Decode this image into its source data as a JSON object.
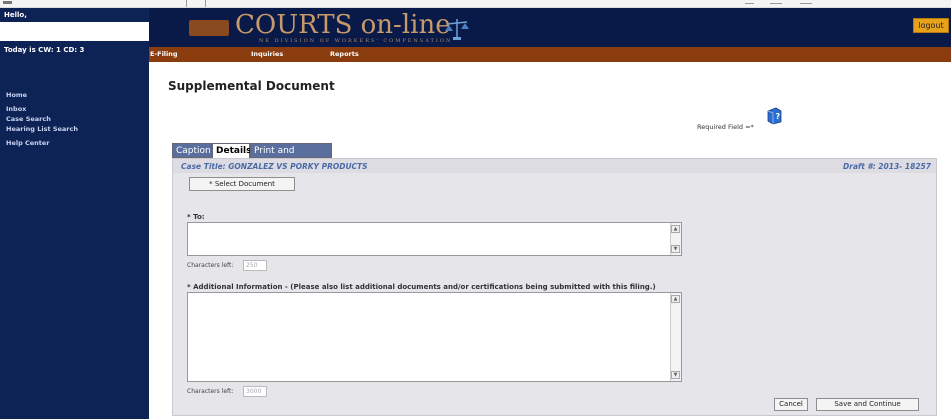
{
  "sidebar": {
    "greeting": "Hello,",
    "today": "Today is CW: 1 CD: 3",
    "items": [
      {
        "label": "Home"
      },
      {
        "label": "Inbox"
      },
      {
        "label": "Case Search"
      },
      {
        "label": "Hearing List Search"
      },
      {
        "label": "Help Center"
      }
    ]
  },
  "banner": {
    "title": "COURTS on-line",
    "subtitle": "NE DIVISION OF WORKERS' COMPENSATION",
    "logout_label": "logout"
  },
  "menu": {
    "items": [
      {
        "label": "E-Filing"
      },
      {
        "label": "Inquiries"
      },
      {
        "label": "Reports"
      }
    ]
  },
  "page": {
    "title": "Supplemental Document",
    "required_note": "Required Field =*"
  },
  "tabs": [
    {
      "label": "Caption",
      "active": false
    },
    {
      "label": "Details",
      "active": true
    },
    {
      "label": "Print and Submit",
      "active": false
    }
  ],
  "form": {
    "case_title": "Case Title: GONZALEZ VS PORKY PRODUCTS",
    "draft": "Draft #: 2013- 18257",
    "select_document_label": "* Select Document",
    "to_label": "* To:",
    "to_value": "",
    "to_chars_label": "Characters left:",
    "to_chars_left": "250",
    "addl_label": "* Additional Information - (Please also list additional documents and/or certifications being submitted with this filing.)",
    "addl_value": "",
    "addl_chars_label": "Characters left:",
    "addl_chars_left": "3000",
    "cancel_label": "Cancel",
    "save_label": "Save and Continue"
  },
  "icons": {
    "help": "help-book-icon",
    "scales": "scales-of-justice-icon"
  },
  "colors": {
    "sidebar": "#0d2255",
    "banner": "#0a1a48",
    "menubar": "#8a3c0f",
    "logout": "#e8a21a",
    "tab_inactive": "#5a6f9e",
    "case_text": "#4a6aa6"
  }
}
